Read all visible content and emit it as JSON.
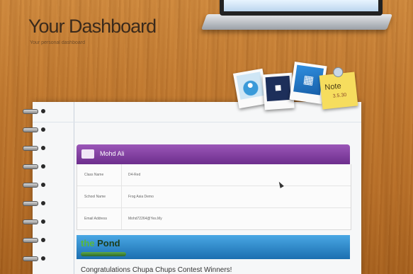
{
  "header": {
    "title": "Your Dashboard",
    "subtitle": "Your personal dashboard"
  },
  "note": {
    "title": "Note",
    "detail": "3.5.30"
  },
  "icons": {
    "photos": "photo-album-icon",
    "media": "media-player-icon",
    "apps": "apps-icon",
    "note": "sticky-note-icon",
    "profile": "profile-card-icon"
  },
  "profile": {
    "name": "Mohd Ali",
    "rows": [
      {
        "label": "Class Name",
        "value": "D4-Red"
      },
      {
        "label": "School Name",
        "value": "Frog Asia Demo"
      },
      {
        "label": "Email Address",
        "value": "Mohd72264@Yes.My"
      }
    ]
  },
  "pond": {
    "logo_prefix": "the ",
    "logo_word": "Pond",
    "headline": "Congratulations Chupa Chups Contest Winners!"
  },
  "colors": {
    "profile_header": "#7a3a9a",
    "pond_banner": "#2a85c8",
    "note_paper": "#f6dd5e"
  }
}
